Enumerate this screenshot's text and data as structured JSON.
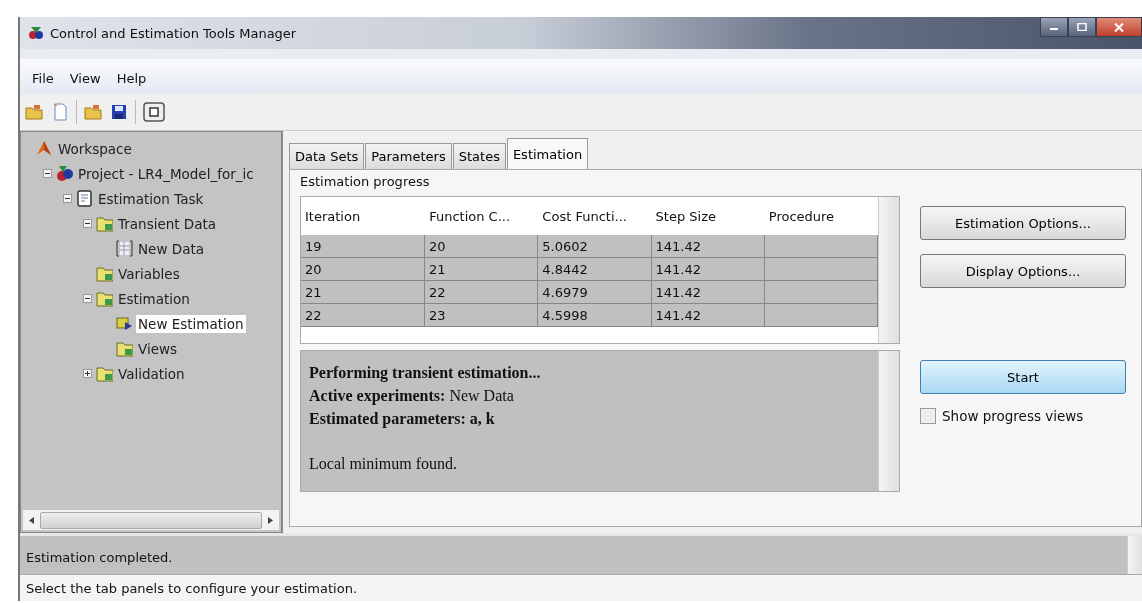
{
  "window": {
    "title": "Control and Estimation Tools Manager"
  },
  "menu": [
    {
      "label": "File"
    },
    {
      "label": "View"
    },
    {
      "label": "Help"
    }
  ],
  "toolbar": [
    {
      "kind": "open-folder"
    },
    {
      "kind": "new-page"
    },
    {
      "kind": "separator"
    },
    {
      "kind": "open-folder"
    },
    {
      "kind": "save"
    },
    {
      "kind": "separator"
    },
    {
      "kind": "frame"
    }
  ],
  "tree": [
    {
      "label": "Workspace",
      "kind": "workspace",
      "selected": false,
      "children": [
        {
          "label": "Project - LR4_Model_for_ic",
          "kind": "project",
          "selected": false,
          "expanded": true,
          "children": [
            {
              "label": "Estimation Task",
              "kind": "task",
              "selected": false,
              "expanded": true,
              "children": [
                {
                  "label": "Transient Data",
                  "kind": "folder",
                  "selected": false,
                  "expanded": true,
                  "children": [
                    {
                      "label": "New Data",
                      "kind": "data",
                      "selected": false
                    }
                  ]
                },
                {
                  "label": "Variables",
                  "kind": "folder",
                  "selected": false
                },
                {
                  "label": "Estimation",
                  "kind": "folder",
                  "selected": false,
                  "expanded": true,
                  "children": [
                    {
                      "label": "New Estimation",
                      "kind": "estimation",
                      "selected": true
                    },
                    {
                      "label": "Views",
                      "kind": "folder",
                      "selected": false
                    }
                  ]
                },
                {
                  "label": "Validation",
                  "kind": "folder",
                  "selected": false,
                  "expanded": false
                }
              ]
            }
          ]
        }
      ]
    }
  ],
  "tabs": [
    {
      "label": "Data Sets",
      "selected": false
    },
    {
      "label": "Parameters",
      "selected": false
    },
    {
      "label": "States",
      "selected": false
    },
    {
      "label": "Estimation",
      "selected": true
    }
  ],
  "panel": {
    "title": "Estimation progress",
    "table": {
      "columns": [
        "Iteration",
        "Function C...",
        "Cost Functi...",
        "Step Size",
        "Procedure"
      ],
      "rows": [
        [
          "19",
          "20",
          "5.0602",
          "141.42",
          null
        ],
        [
          "20",
          "21",
          "4.8442",
          "141.42",
          null
        ],
        [
          "21",
          "22",
          "4.6979",
          "141.42",
          null
        ],
        [
          "22",
          "23",
          "4.5998",
          "141.42",
          null
        ]
      ]
    },
    "log": [
      [
        "**Performing transient estimation...**",
        "**Active experiments:** New Data",
        "**Estimated parameters: a, k**"
      ],
      [
        "Local minimum found."
      ]
    ],
    "buttons": [
      {
        "label": "Estimation Options...",
        "default": false
      },
      {
        "label": "Display Options...",
        "default": false
      },
      {
        "label": "Start",
        "default": true
      }
    ],
    "checkbox": {
      "label": "Show progress views",
      "checked": false
    }
  },
  "message_log": [
    "Estimation completed."
  ],
  "status_bar": "Select the tab panels to configure your estimation."
}
